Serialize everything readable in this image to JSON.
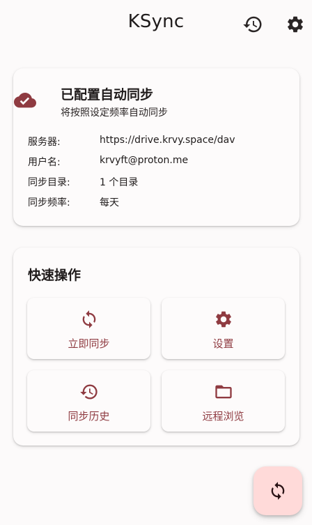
{
  "appbar": {
    "title": "KSync",
    "history_icon": "history-icon",
    "settings_icon": "gear-icon"
  },
  "status": {
    "icon": "cloud-done-icon",
    "title": "已配置自动同步",
    "subtitle": "将按照设定频率自动同步",
    "rows": [
      {
        "label": "服务器:",
        "value": "https://drive.krvy.space/dav"
      },
      {
        "label": "用户名:",
        "value": "krvyft@proton.me"
      },
      {
        "label": "同步目录:",
        "value": "1 个目录"
      },
      {
        "label": "同步频率:",
        "value": "每天"
      }
    ]
  },
  "quick": {
    "title": "快速操作",
    "actions": [
      {
        "label": "立即同步",
        "icon": "sync-icon"
      },
      {
        "label": "设置",
        "icon": "gear-icon"
      },
      {
        "label": "同步历史",
        "icon": "history-icon"
      },
      {
        "label": "远程浏览",
        "icon": "folder-icon"
      }
    ]
  },
  "fab": {
    "icon": "sync-icon"
  },
  "colors": {
    "accent": "#8f3b41",
    "fab_background": "#ffdad9",
    "background": "#fcfafa",
    "text": "#1f1b1b"
  }
}
